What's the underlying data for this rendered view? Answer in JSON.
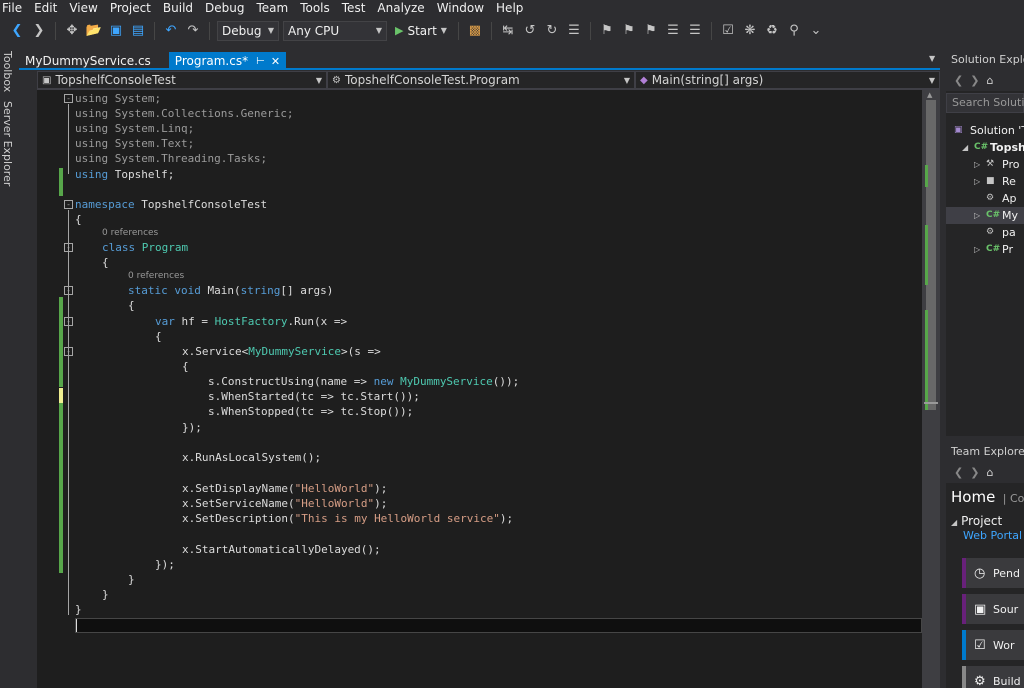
{
  "menu": [
    "File",
    "Edit",
    "View",
    "Project",
    "Build",
    "Debug",
    "Team",
    "Tools",
    "Test",
    "Analyze",
    "Window",
    "Help"
  ],
  "toolbar": {
    "configuration": "Debug",
    "platform": "Any CPU",
    "start_label": "Start"
  },
  "left_strip": {
    "toolbox": "Toolbox",
    "server_explorer": "Server Explorer"
  },
  "tabs": [
    {
      "label": "MyDummyService.cs",
      "active": false
    },
    {
      "label": "Program.cs*",
      "active": true
    }
  ],
  "navbar": {
    "project": "TopshelfConsoleTest",
    "type": "TopshelfConsoleTest.Program",
    "member": "Main(string[] args)"
  },
  "code": {
    "lens_refs": "0 references",
    "lines": [
      "using System;",
      "using System.Collections.Generic;",
      "using System.Linq;",
      "using System.Text;",
      "using System.Threading.Tasks;",
      "using Topshelf;",
      "",
      "namespace TopshelfConsoleTest",
      "{",
      "class Program",
      "{",
      "static void Main(string[] args)",
      "{",
      "var hf = HostFactory.Run(x =>",
      "{",
      "x.Service<MyDummyService>(s =>",
      "{",
      "s.ConstructUsing(name => new MyDummyService());",
      "s.WhenStarted(tc => tc.Start());",
      "s.WhenStopped(tc => tc.Stop());",
      "});",
      "",
      "x.RunAsLocalSystem();",
      "",
      "x.SetDisplayName(\"HelloWorld\");",
      "x.SetServiceName(\"HelloWorld\");",
      "x.SetDescription(\"This is my HelloWorld service\");",
      "",
      "x.StartAutomaticallyDelayed();",
      "});",
      "}",
      "}",
      "}"
    ]
  },
  "solution_explorer": {
    "title": "Solution Explorer",
    "search_placeholder": "Search Solution",
    "items": [
      {
        "label": "Solution 'T",
        "icon": "solution-icon"
      },
      {
        "label": "Topsh",
        "icon": "csharp-project-icon"
      },
      {
        "label": "Pro",
        "icon": "wrench-icon"
      },
      {
        "label": "Re",
        "icon": "references-icon"
      },
      {
        "label": "Ap",
        "icon": "config-icon"
      },
      {
        "label": "My",
        "icon": "csharp-file-icon"
      },
      {
        "label": "pa",
        "icon": "config-icon"
      },
      {
        "label": "Pr",
        "icon": "csharp-file-icon"
      }
    ]
  },
  "team_explorer": {
    "title": "Team Explorer",
    "home": "Home",
    "home_sub": "Corp",
    "project": "Project",
    "web_portal": "Web Portal",
    "tiles": [
      {
        "label": "Pend",
        "color": "#68217a",
        "icon": "clock-icon"
      },
      {
        "label": "Sour",
        "color": "#68217a",
        "icon": "source-icon"
      },
      {
        "label": "Wor",
        "color": "#007acc",
        "icon": "work-items-icon"
      },
      {
        "label": "Build",
        "color": "#888888",
        "icon": "build-icon"
      }
    ]
  }
}
